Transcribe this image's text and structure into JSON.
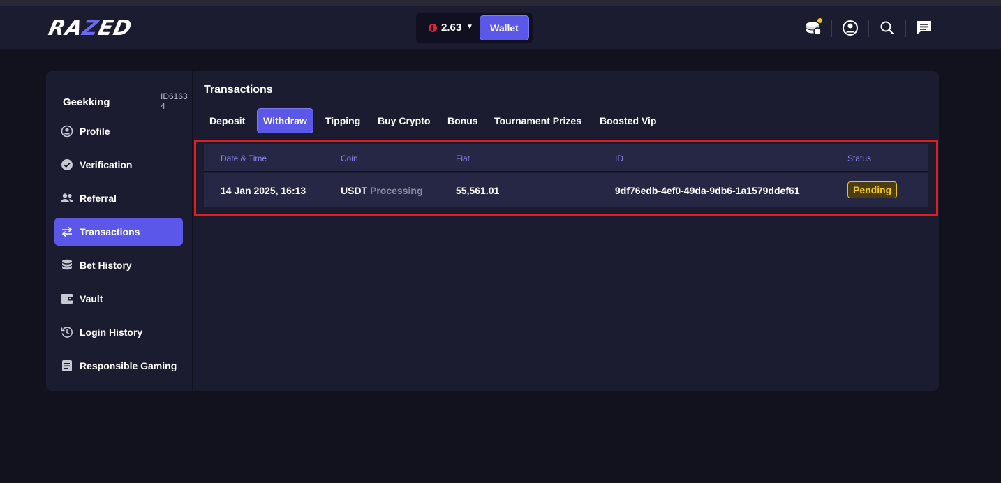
{
  "header": {
    "logo_text": "RAZED",
    "balance": "2.63",
    "wallet_label": "Wallet",
    "icons": [
      "coins-icon",
      "user-circle-icon",
      "search-icon",
      "chat-icon"
    ]
  },
  "sidebar": {
    "username": "Geekking",
    "user_id": "ID61634",
    "items": [
      {
        "label": "Profile",
        "icon": "user-circle-icon"
      },
      {
        "label": "Verification",
        "icon": "check-circle-icon"
      },
      {
        "label": "Referral",
        "icon": "users-icon"
      },
      {
        "label": "Transactions",
        "icon": "swap-arrows-icon",
        "active": true
      },
      {
        "label": "Bet History",
        "icon": "database-icon"
      },
      {
        "label": "Vault",
        "icon": "wallet-icon"
      },
      {
        "label": "Login History",
        "icon": "history-icon"
      },
      {
        "label": "Responsible Gaming",
        "icon": "document-icon"
      }
    ]
  },
  "main": {
    "title": "Transactions",
    "tabs": [
      {
        "label": "Deposit"
      },
      {
        "label": "Withdraw",
        "active": true
      },
      {
        "label": "Tipping"
      },
      {
        "label": "Buy Crypto"
      },
      {
        "label": "Bonus"
      },
      {
        "label": "Tournament Prizes"
      },
      {
        "label": "Boosted Vip"
      }
    ],
    "table": {
      "columns": [
        "Date & Time",
        "Coin",
        "Fiat",
        "ID",
        "Status"
      ],
      "rows": [
        {
          "datetime": "14 Jan 2025, 16:13",
          "coin": "USDT",
          "coin_status": "Processing",
          "fiat": "55,561.01",
          "id": "9df76edb-4ef0-49da-9db6-1a1579ddef61",
          "status": "Pending"
        }
      ]
    }
  },
  "colors": {
    "accent": "#5b57e8",
    "background": "#12121f",
    "panel": "#1c1c30",
    "pending": "#f5c518",
    "highlight": "#e11d24"
  }
}
